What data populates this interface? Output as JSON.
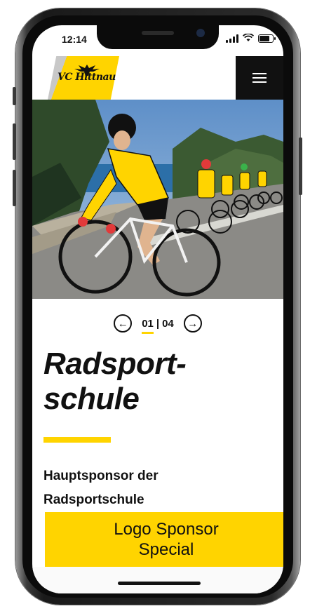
{
  "status_bar": {
    "time": "12:14"
  },
  "header": {
    "logo_text": "VC Hittnau",
    "menu_icon": "hamburger-menu-icon"
  },
  "hero": {
    "image_description_icon": "cyclists-photo"
  },
  "pager": {
    "current": "01",
    "separator": "|",
    "total": "04",
    "prev_icon": "arrow-left-icon",
    "next_icon": "arrow-right-icon"
  },
  "page": {
    "title": "Radsport-\nschule",
    "sponsor_heading": "Hauptsponsor der\nRadsportschule",
    "sponsor_box_label": "Logo Sponsor\nSpecial"
  },
  "colors": {
    "accent": "#ffd400",
    "dark": "#111111"
  }
}
